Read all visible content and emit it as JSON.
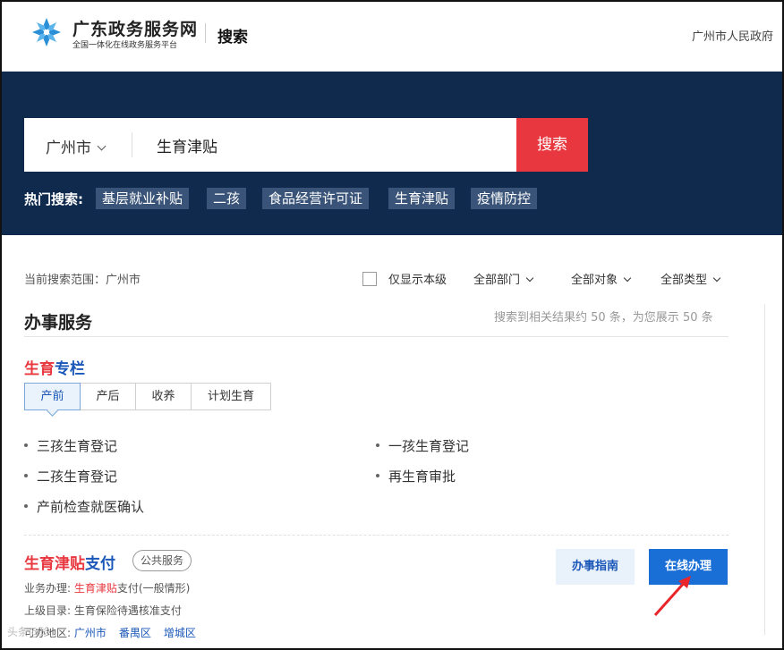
{
  "header": {
    "site_name": "广东政务服务网",
    "site_subtitle": "全国一体化在线政务服务平台",
    "page_title": "搜索",
    "right_text": "广州市人民政府"
  },
  "search": {
    "city": "广州市",
    "query": "生育津贴",
    "button_label": "搜索",
    "hot_label": "热门搜索:",
    "hot_tags": [
      "基层就业补贴",
      "二孩",
      "食品经营许可证",
      "生育津贴",
      "疫情防控"
    ]
  },
  "filters": {
    "scope_label": "当前搜索范围：",
    "scope_value": "广州市",
    "only_level_label": "仅显示本级",
    "department": "全部部门",
    "target": "全部对象",
    "type": "全部类型"
  },
  "section": {
    "title": "办事服务",
    "result_count": "搜索到相关结果约 50 条，为您展示 50 条"
  },
  "birth_column": {
    "title_red": "生育",
    "title_blue": "专栏",
    "tabs": [
      "产前",
      "产后",
      "收养",
      "计划生育"
    ],
    "active_tab": "产前",
    "items_left": [
      "三孩生育登记",
      "二孩生育登记",
      "产前检查就医确认"
    ],
    "items_right": [
      "一孩生育登记",
      "再生育审批"
    ]
  },
  "result": {
    "title_red": "生育津贴",
    "title_blue": "支付",
    "badge": "公共服务",
    "business_label": "业务办理:",
    "business_red": "生育津贴",
    "business_rest": "支付(一般情形)",
    "parent_label": "上级目录:",
    "parent_value": "生育保险待遇核准支付",
    "region_label": "可办地区:",
    "regions": [
      "广州市",
      "番禺区",
      "增城区"
    ],
    "guide_button": "办事指南",
    "online_button": "在线办理"
  },
  "watermark": "头条@珍",
  "colors": {
    "hero_bg": "#0f2a4d",
    "search_red": "#e8373e",
    "link_blue": "#1a57b8",
    "primary_blue": "#1a6fd6",
    "annotation_red": "#e8252b"
  }
}
